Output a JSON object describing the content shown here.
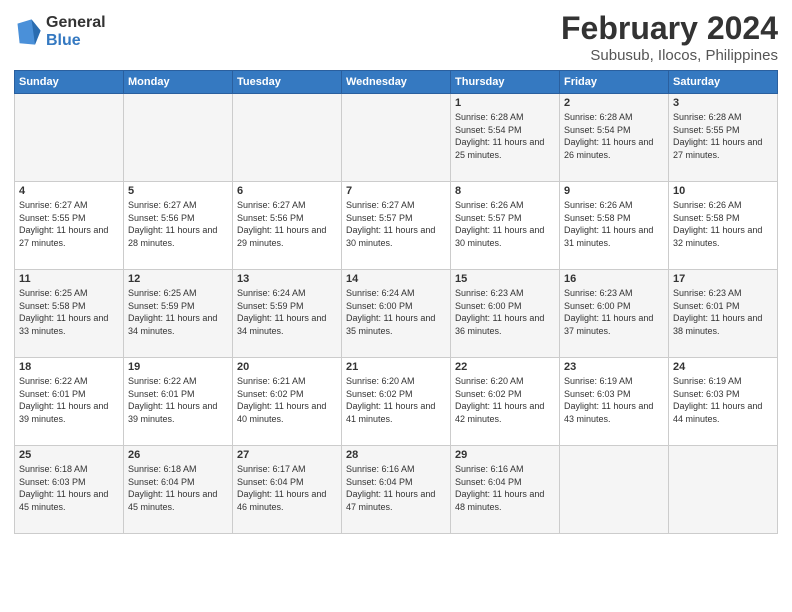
{
  "header": {
    "logo_line1": "General",
    "logo_line2": "Blue",
    "title": "February 2024",
    "subtitle": "Subusub, Ilocos, Philippines"
  },
  "weekdays": [
    "Sunday",
    "Monday",
    "Tuesday",
    "Wednesday",
    "Thursday",
    "Friday",
    "Saturday"
  ],
  "weeks": [
    [
      {
        "day": "",
        "info": ""
      },
      {
        "day": "",
        "info": ""
      },
      {
        "day": "",
        "info": ""
      },
      {
        "day": "",
        "info": ""
      },
      {
        "day": "1",
        "info": "Sunrise: 6:28 AM\nSunset: 5:54 PM\nDaylight: 11 hours\nand 25 minutes."
      },
      {
        "day": "2",
        "info": "Sunrise: 6:28 AM\nSunset: 5:54 PM\nDaylight: 11 hours\nand 26 minutes."
      },
      {
        "day": "3",
        "info": "Sunrise: 6:28 AM\nSunset: 5:55 PM\nDaylight: 11 hours\nand 27 minutes."
      }
    ],
    [
      {
        "day": "4",
        "info": "Sunrise: 6:27 AM\nSunset: 5:55 PM\nDaylight: 11 hours\nand 27 minutes."
      },
      {
        "day": "5",
        "info": "Sunrise: 6:27 AM\nSunset: 5:56 PM\nDaylight: 11 hours\nand 28 minutes."
      },
      {
        "day": "6",
        "info": "Sunrise: 6:27 AM\nSunset: 5:56 PM\nDaylight: 11 hours\nand 29 minutes."
      },
      {
        "day": "7",
        "info": "Sunrise: 6:27 AM\nSunset: 5:57 PM\nDaylight: 11 hours\nand 30 minutes."
      },
      {
        "day": "8",
        "info": "Sunrise: 6:26 AM\nSunset: 5:57 PM\nDaylight: 11 hours\nand 30 minutes."
      },
      {
        "day": "9",
        "info": "Sunrise: 6:26 AM\nSunset: 5:58 PM\nDaylight: 11 hours\nand 31 minutes."
      },
      {
        "day": "10",
        "info": "Sunrise: 6:26 AM\nSunset: 5:58 PM\nDaylight: 11 hours\nand 32 minutes."
      }
    ],
    [
      {
        "day": "11",
        "info": "Sunrise: 6:25 AM\nSunset: 5:58 PM\nDaylight: 11 hours\nand 33 minutes."
      },
      {
        "day": "12",
        "info": "Sunrise: 6:25 AM\nSunset: 5:59 PM\nDaylight: 11 hours\nand 34 minutes."
      },
      {
        "day": "13",
        "info": "Sunrise: 6:24 AM\nSunset: 5:59 PM\nDaylight: 11 hours\nand 34 minutes."
      },
      {
        "day": "14",
        "info": "Sunrise: 6:24 AM\nSunset: 6:00 PM\nDaylight: 11 hours\nand 35 minutes."
      },
      {
        "day": "15",
        "info": "Sunrise: 6:23 AM\nSunset: 6:00 PM\nDaylight: 11 hours\nand 36 minutes."
      },
      {
        "day": "16",
        "info": "Sunrise: 6:23 AM\nSunset: 6:00 PM\nDaylight: 11 hours\nand 37 minutes."
      },
      {
        "day": "17",
        "info": "Sunrise: 6:23 AM\nSunset: 6:01 PM\nDaylight: 11 hours\nand 38 minutes."
      }
    ],
    [
      {
        "day": "18",
        "info": "Sunrise: 6:22 AM\nSunset: 6:01 PM\nDaylight: 11 hours\nand 39 minutes."
      },
      {
        "day": "19",
        "info": "Sunrise: 6:22 AM\nSunset: 6:01 PM\nDaylight: 11 hours\nand 39 minutes."
      },
      {
        "day": "20",
        "info": "Sunrise: 6:21 AM\nSunset: 6:02 PM\nDaylight: 11 hours\nand 40 minutes."
      },
      {
        "day": "21",
        "info": "Sunrise: 6:20 AM\nSunset: 6:02 PM\nDaylight: 11 hours\nand 41 minutes."
      },
      {
        "day": "22",
        "info": "Sunrise: 6:20 AM\nSunset: 6:02 PM\nDaylight: 11 hours\nand 42 minutes."
      },
      {
        "day": "23",
        "info": "Sunrise: 6:19 AM\nSunset: 6:03 PM\nDaylight: 11 hours\nand 43 minutes."
      },
      {
        "day": "24",
        "info": "Sunrise: 6:19 AM\nSunset: 6:03 PM\nDaylight: 11 hours\nand 44 minutes."
      }
    ],
    [
      {
        "day": "25",
        "info": "Sunrise: 6:18 AM\nSunset: 6:03 PM\nDaylight: 11 hours\nand 45 minutes."
      },
      {
        "day": "26",
        "info": "Sunrise: 6:18 AM\nSunset: 6:04 PM\nDaylight: 11 hours\nand 45 minutes."
      },
      {
        "day": "27",
        "info": "Sunrise: 6:17 AM\nSunset: 6:04 PM\nDaylight: 11 hours\nand 46 minutes."
      },
      {
        "day": "28",
        "info": "Sunrise: 6:16 AM\nSunset: 6:04 PM\nDaylight: 11 hours\nand 47 minutes."
      },
      {
        "day": "29",
        "info": "Sunrise: 6:16 AM\nSunset: 6:04 PM\nDaylight: 11 hours\nand 48 minutes."
      },
      {
        "day": "",
        "info": ""
      },
      {
        "day": "",
        "info": ""
      }
    ]
  ]
}
